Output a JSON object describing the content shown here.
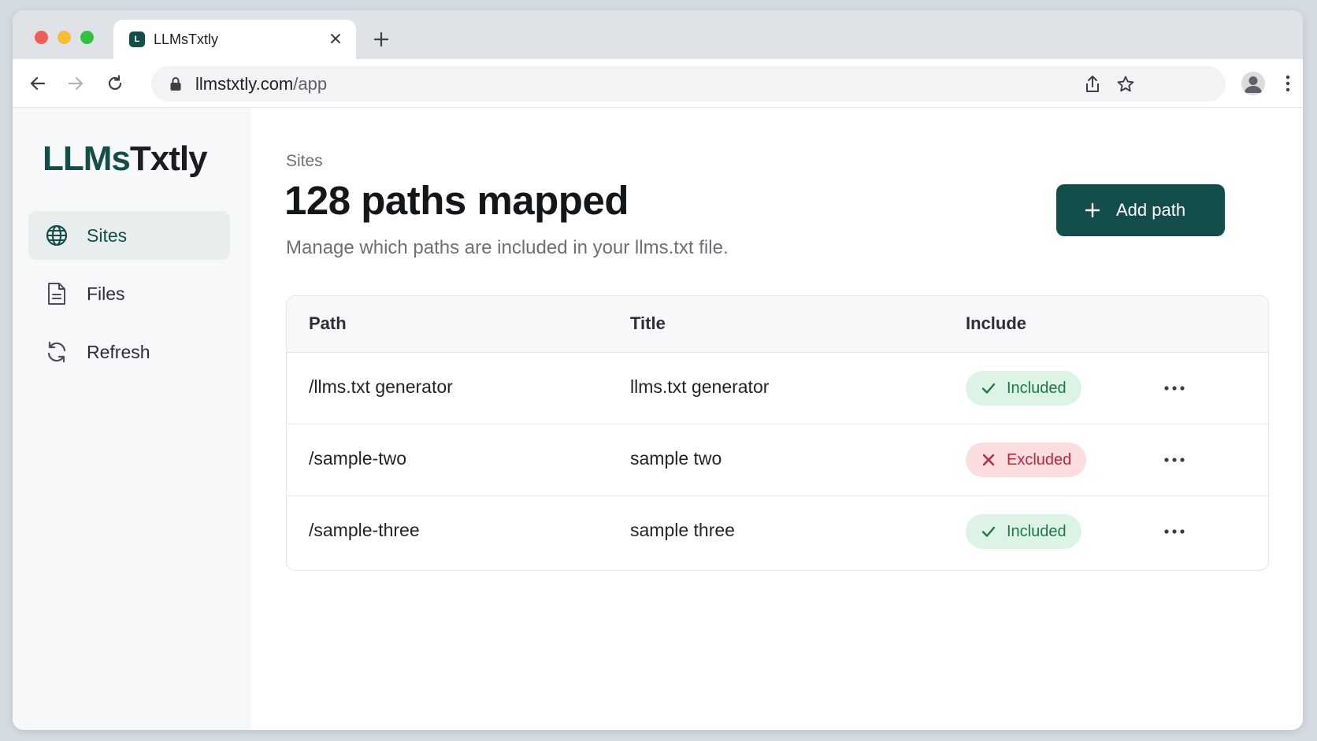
{
  "browser": {
    "tab_title": "LLMsTxtly",
    "favicon_text": "L",
    "url_domain": "llmstxtly.com",
    "url_path": "/app"
  },
  "sidebar": {
    "brand_accent": "LLMs",
    "brand_rest": "Txtly",
    "items": [
      {
        "label": "Sites",
        "icon": "globe-icon",
        "active": true
      },
      {
        "label": "Files",
        "icon": "file-icon",
        "active": false
      },
      {
        "label": "Refresh",
        "icon": "refresh-icon",
        "active": false
      }
    ]
  },
  "header": {
    "breadcrumb": "Sites",
    "title": "128 paths mapped",
    "subtitle": "Manage which paths are included in your llms.txt file.",
    "add_button_label": "Add path"
  },
  "table": {
    "columns": [
      "Path",
      "Title",
      "Include"
    ],
    "rows": [
      {
        "path": "/llms.txt generator",
        "title": "llms.txt generator",
        "status": "Included"
      },
      {
        "path": "/sample-two",
        "title": "sample two",
        "status": "Excluded"
      },
      {
        "path": "/sample-three",
        "title": "sample three",
        "status": "Included"
      }
    ]
  },
  "colors": {
    "accent": "#134e4a",
    "included_bg": "#dcf3e6",
    "included_fg": "#1b7a45",
    "excluded_bg": "#fbdde0",
    "excluded_fg": "#c0243a"
  }
}
